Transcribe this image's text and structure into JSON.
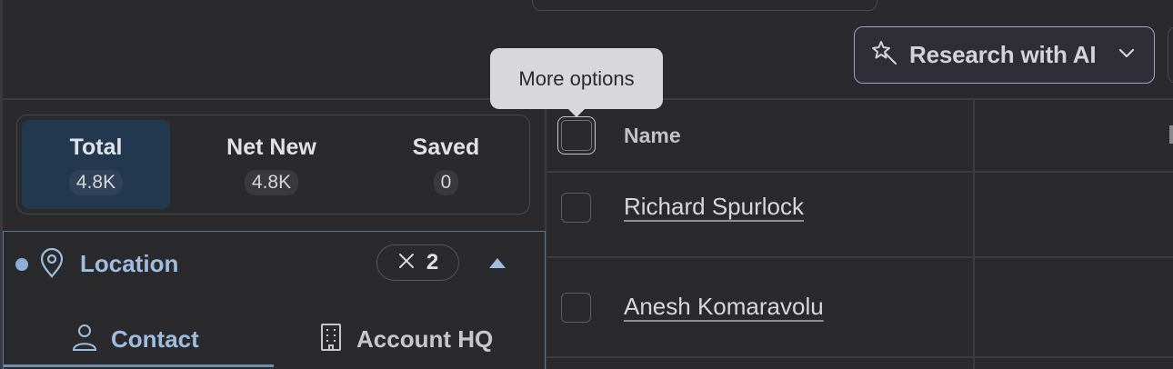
{
  "toolbar": {
    "research_label": "Research with AI"
  },
  "tooltip": {
    "text": "More options"
  },
  "stats": [
    {
      "label": "Total",
      "count": "4.8K"
    },
    {
      "label": "Net New",
      "count": "4.8K"
    },
    {
      "label": "Saved",
      "count": "0"
    }
  ],
  "filter": {
    "label": "Location",
    "count": "2",
    "tabs": [
      {
        "label": "Contact"
      },
      {
        "label": "Account HQ"
      }
    ]
  },
  "table": {
    "name_header": "Name",
    "rows": [
      {
        "name": "Richard Spurlock"
      },
      {
        "name": "Anesh Komaravolu"
      }
    ]
  },
  "colors": {
    "accent": "#a89bd6",
    "active_tab_bg": "#22384f",
    "filter_border": "#5a7897",
    "link_blue": "#9ebde0"
  },
  "icons": {
    "research": "magic-wand-icon",
    "chevron": "chevron-down-icon",
    "location": "map-pin-icon",
    "clear": "close-icon",
    "collapse": "caret-up-icon",
    "contact": "person-icon",
    "account": "building-icon"
  }
}
